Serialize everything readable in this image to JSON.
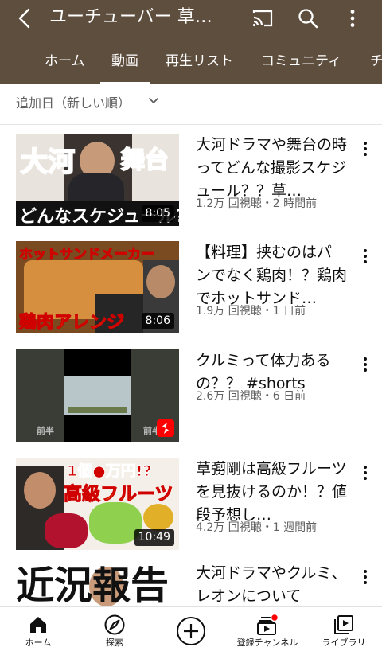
{
  "header": {
    "title": "ユーチューバー 草…",
    "tabs": [
      {
        "label": "ホーム"
      },
      {
        "label": "動画"
      },
      {
        "label": "再生リスト"
      },
      {
        "label": "コミュニティ"
      },
      {
        "label": "チ"
      }
    ]
  },
  "sort": {
    "label": "追加日（新しい順）"
  },
  "videos": [
    {
      "title": "大河ドラマや舞台の時ってどんな撮影スケジュール？？草…",
      "meta": "1.2万 回視聴・2 時間前",
      "duration": "8:05",
      "thumb_text": [
        "大河",
        "舞台",
        "どんなスケジュール?"
      ]
    },
    {
      "title": "【料理】挟むのはパンでなく鶏肉！？鶏肉でホットサンド…",
      "meta": "1.9万 回視聴・1 日前",
      "duration": "8:06",
      "thumb_text": [
        "ホットサンドメーカー",
        "鶏肉アレンジ"
      ]
    },
    {
      "title": "クルミって体力あるの？？ #shorts",
      "meta": "2.6万 回視聴・6 日前",
      "duration": "",
      "thumb_text": [
        "前半",
        "前半"
      ]
    },
    {
      "title": "草彅剛は高級フルーツを見抜けるのか！？値段予想し…",
      "meta": "4.2万 回視聴・1 週間前",
      "duration": "10:49",
      "thumb_text": [
        "1個●万円!?",
        "高級フルーツ"
      ]
    },
    {
      "title": "大河ドラマやクルミ、レオンについて",
      "meta": "",
      "duration": "",
      "thumb_text": [
        "近況報告"
      ]
    }
  ],
  "bottom_nav": [
    {
      "label": "ホーム",
      "icon": "home-icon"
    },
    {
      "label": "探索",
      "icon": "compass-icon"
    },
    {
      "label": "",
      "icon": "create-icon"
    },
    {
      "label": "登録チャンネル",
      "icon": "subscriptions-icon"
    },
    {
      "label": "ライブラリ",
      "icon": "library-icon"
    }
  ],
  "colors": {
    "header_bg": "#5e4e3e",
    "notification_dot": "#ff0000",
    "shorts_red": "#ff0000"
  }
}
